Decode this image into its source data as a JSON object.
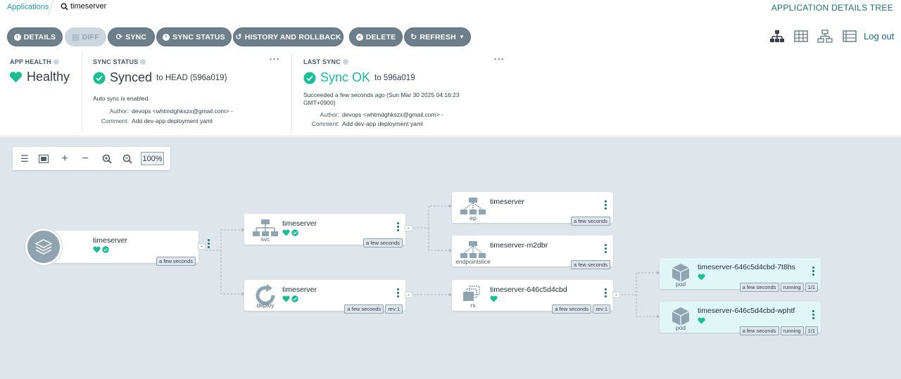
{
  "breadcrumb": {
    "applications": "Applications",
    "search": "timeserver"
  },
  "page_title": "APPLICATION DETAILS TREE",
  "toolbar": {
    "details": "DETAILS",
    "diff": "DIFF",
    "sync": "SYNC",
    "sync_status": "SYNC STATUS",
    "history": "HISTORY AND ROLLBACK",
    "delete": "DELETE",
    "refresh": "REFRESH"
  },
  "logout": "Log out",
  "app_health": {
    "title": "APP HEALTH",
    "value": "Healthy"
  },
  "sync_status": {
    "title": "SYNC STATUS",
    "value": "Synced",
    "target": "to HEAD (596a019)",
    "auto": "Auto sync is enabled.",
    "author_label": "Author:",
    "author": "devops <whtmdghkszx@gmail.com> -",
    "comment_label": "Comment:",
    "comment": "Add dev-app deployment yaml"
  },
  "last_sync": {
    "title": "LAST SYNC",
    "value": "Sync OK",
    "target": "to 596a019",
    "succeeded": "Succeeded a few seconds ago (Sun Mar 30 2025 04:16:23 GMT+0900)",
    "author_label": "Author:",
    "author": "devops <whtmdghkszx@gmail.com> -",
    "comment_label": "Comment:",
    "comment": "Add dev-app deployment yaml"
  },
  "zoom": "100%",
  "nodes": {
    "root": {
      "name": "timeserver",
      "age": "a few seconds"
    },
    "svc": {
      "name": "timeserver",
      "kind": "svc",
      "age": "a few seconds"
    },
    "deploy": {
      "name": "timeserver",
      "kind": "deploy",
      "age": "a few seconds",
      "rev": "rev:1"
    },
    "ep": {
      "name": "timeserver",
      "kind": "ep",
      "age": "a few seconds"
    },
    "eps": {
      "name": "timeserver-m2dbr",
      "kind": "endpointslice",
      "age": "a few seconds"
    },
    "rs": {
      "name": "timeserver-646c5d4cbd",
      "kind": "rs",
      "age": "a few seconds",
      "rev": "rev:1"
    },
    "pod1": {
      "name": "timeserver-646c5d4cbd-7t8hs",
      "kind": "pod",
      "age": "a few seconds",
      "status": "running",
      "ready": "1/1"
    },
    "pod2": {
      "name": "timeserver-646c5d4cbd-wphtf",
      "kind": "pod",
      "age": "a few seconds",
      "status": "running",
      "ready": "1/1"
    }
  },
  "colors": {
    "accent": "#1a6f7d",
    "healthy": "#18be94",
    "button": "#6d7f8b",
    "canvas": "#dee6eb"
  }
}
